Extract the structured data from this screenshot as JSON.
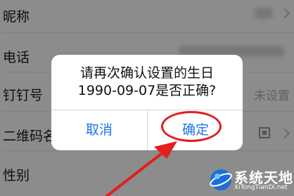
{
  "profile_rows": [
    {
      "label": "昵称"
    },
    {
      "label": "电话"
    },
    {
      "label": "钉钉号",
      "trailing": "未设置"
    },
    {
      "label": "二维码名"
    },
    {
      "label": "性别"
    }
  ],
  "dialog": {
    "message_line1": "请再次确认设置的生日",
    "message_line2": "1990-09-07是否正确?",
    "cancel_label": "取消",
    "confirm_label": "确定"
  },
  "annotation": {
    "color": "#e41e1e"
  },
  "watermark": {
    "title": "系统天地",
    "subtitle": "XiTongTianDi.net"
  },
  "colors": {
    "accent": "#1e74e6",
    "overlay": "rgba(0,0,0,0.45)"
  }
}
